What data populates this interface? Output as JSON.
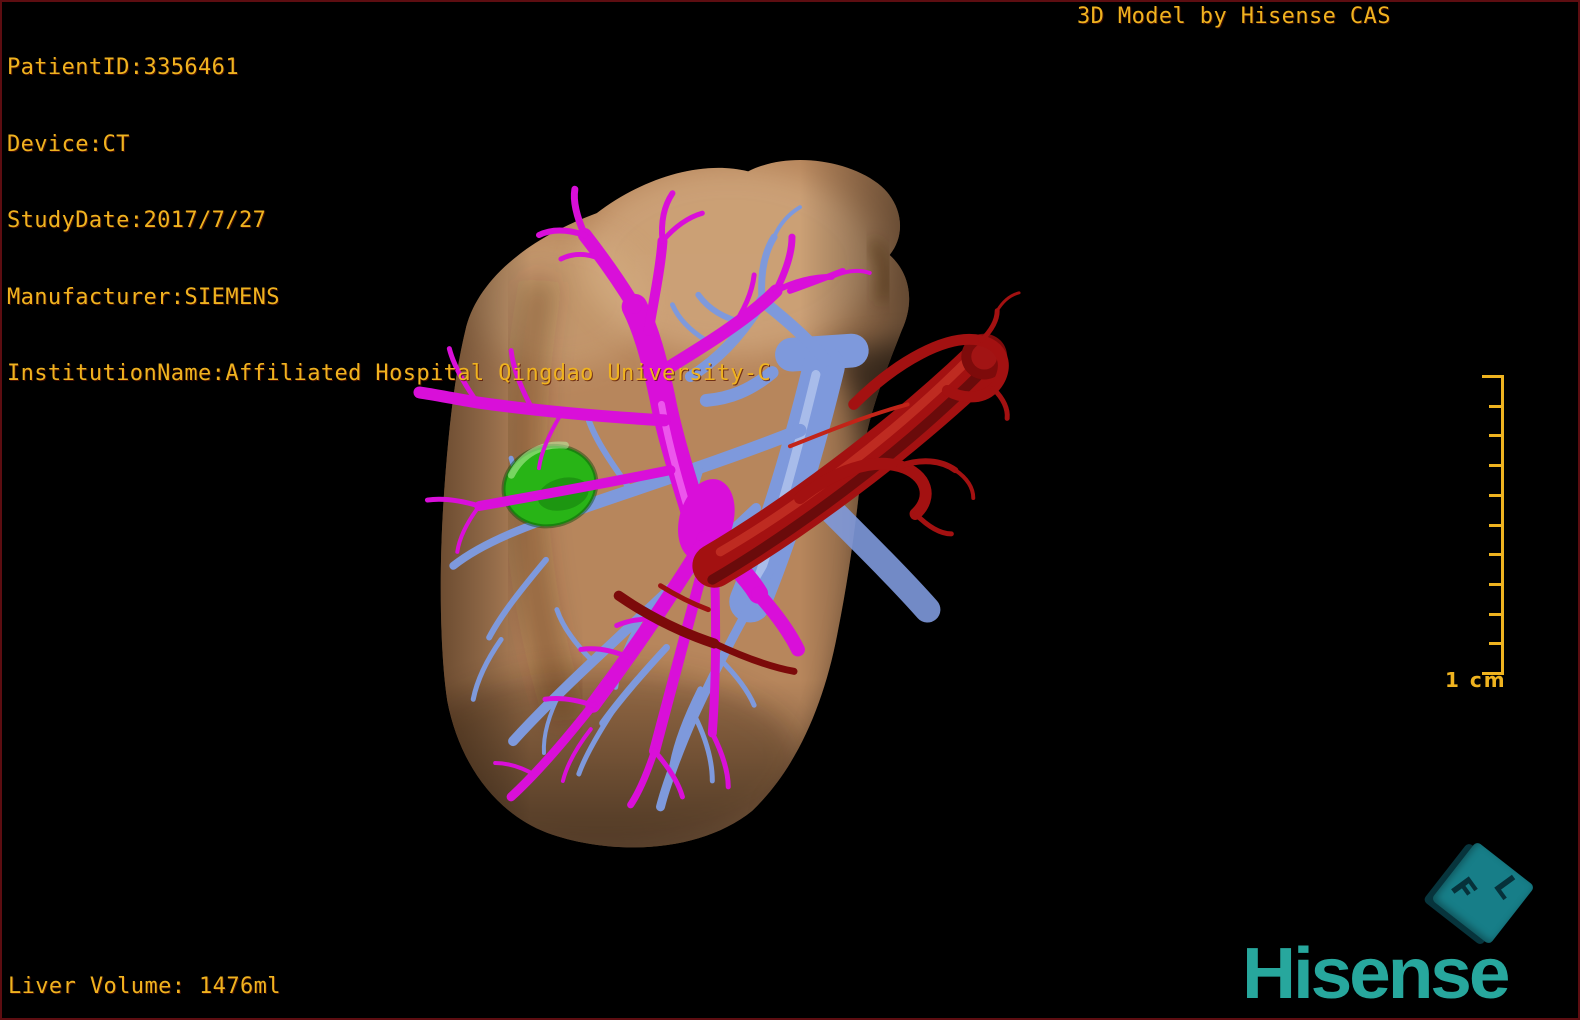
{
  "overlay": {
    "patient_lines": [
      "PatientID:3356461",
      "Device:CT",
      "StudyDate:2017/7/27",
      "Manufacturer:SIEMENS",
      "InstitutionName:Affiliated Hospital Qingdao University-C"
    ],
    "view_title": "3D Model by Hisense CAS",
    "liver_volume": "Liver Volume: 1476ml"
  },
  "scale_bar": {
    "label": "1 cm",
    "tick_count": 11
  },
  "orientation_cube": {
    "letter_front": "F",
    "letter_left": "L"
  },
  "branding": {
    "logo_text": "Hisense"
  },
  "colors": {
    "overlay_text": "#efb31f",
    "frame_border": "#5d0d11",
    "background": "#000000",
    "liver": "#bd8a5f",
    "portal_vein": "#d90fd9",
    "hepatic_vein": "#7e99dc",
    "artery": "#a31111",
    "gallbladder": "#28b416",
    "logo_teal": "#27a79d",
    "cube_teal": "#177e88"
  }
}
